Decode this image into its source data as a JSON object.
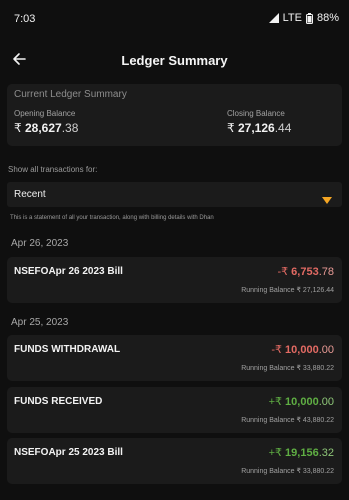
{
  "status_bar": {
    "time": "7:03",
    "network": "LTE",
    "battery": "88%",
    "icons": [
      "signal-icon",
      "battery-icon"
    ]
  },
  "header": {
    "title": "Ledger Summary",
    "back_icon": "arrow-left-icon"
  },
  "summary": {
    "heading": "Current Ledger Summary",
    "opening_label": "Opening Balance",
    "opening_currency": "₹",
    "opening_main": "28,627",
    "opening_dec": ".38",
    "closing_label": "Closing Balance",
    "closing_currency": "₹",
    "closing_main": "27,126",
    "closing_dec": ".44"
  },
  "filter": {
    "label": "Show all transactions for:",
    "selected": "Recent",
    "caret_icon": "caret-down-icon",
    "accent": "#f5a623"
  },
  "note": "This is a statement of all your transaction, along with billing details with Dhan",
  "groups": [
    {
      "date": "Apr 26, 2023",
      "transactions": [
        {
          "name": "NSEFOApr 26 2023  Bill",
          "sign": "-₹ ",
          "main": "6,753",
          "dec": ".78",
          "type": "debit",
          "running": "Running Balance ₹ 27,126.44"
        }
      ]
    },
    {
      "date": "Apr 25, 2023",
      "transactions": [
        {
          "name": "FUNDS WITHDRAWAL",
          "sign": "-₹ ",
          "main": "10,000",
          "dec": ".00",
          "type": "debit",
          "running": "Running Balance ₹ 33,880.22"
        },
        {
          "name": "FUNDS RECEIVED",
          "sign": "+₹ ",
          "main": "10,000",
          "dec": ".00",
          "type": "credit",
          "running": "Running Balance ₹ 43,880.22"
        },
        {
          "name": "NSEFOApr 25 2023  Bill",
          "sign": "+₹ ",
          "main": "19,156",
          "dec": ".32",
          "type": "credit",
          "running": "Running Balance ₹ 33,880.22"
        }
      ]
    }
  ],
  "colors": {
    "background": "#0f0f0f",
    "card": "#1b1b1b",
    "debit": "#e26a63",
    "credit": "#5fae43"
  }
}
